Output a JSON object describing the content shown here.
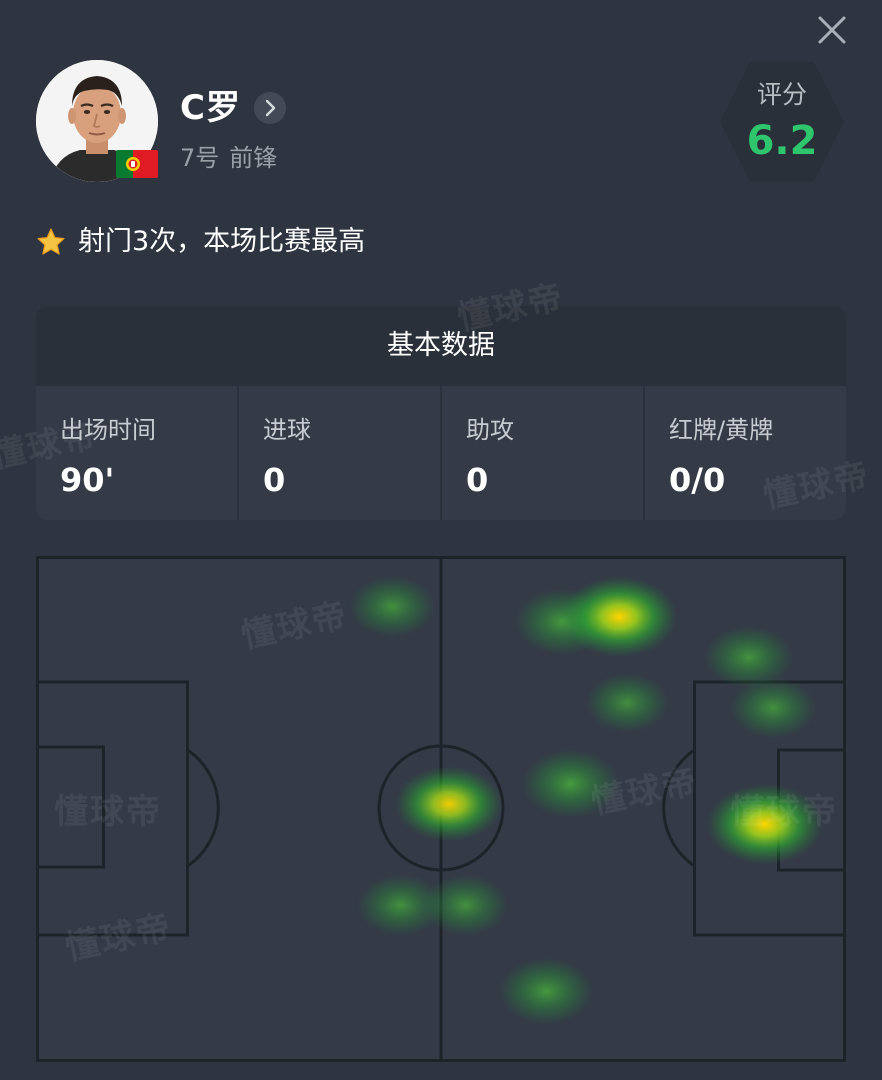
{
  "player": {
    "name": "C罗",
    "number": "7号",
    "position": "前锋",
    "avatar_icon": "player-avatar-icon",
    "flag_icon": "portugal-flag-icon"
  },
  "rating": {
    "label": "评分",
    "value": "6.2",
    "color": "#2ec56c"
  },
  "highlight": {
    "icon": "star-icon",
    "text": "射门3次，本场比赛最高"
  },
  "stats": {
    "title": "基本数据",
    "items": [
      {
        "label": "出场时间",
        "value": "90'"
      },
      {
        "label": "进球",
        "value": "0"
      },
      {
        "label": "助攻",
        "value": "0"
      },
      {
        "label": "红牌/黄牌",
        "value": "0/0"
      }
    ]
  },
  "heatmap": {
    "type": "heatmap",
    "description_icon": "football-pitch-heatmap",
    "spots": [
      {
        "x": 0.44,
        "y": 0.1,
        "intensity": 0.45
      },
      {
        "x": 0.65,
        "y": 0.13,
        "intensity": 0.6
      },
      {
        "x": 0.72,
        "y": 0.12,
        "intensity": 1.0
      },
      {
        "x": 0.88,
        "y": 0.2,
        "intensity": 0.5
      },
      {
        "x": 0.91,
        "y": 0.3,
        "intensity": 0.45
      },
      {
        "x": 0.73,
        "y": 0.29,
        "intensity": 0.4
      },
      {
        "x": 0.51,
        "y": 0.49,
        "intensity": 0.85
      },
      {
        "x": 0.66,
        "y": 0.45,
        "intensity": 0.65
      },
      {
        "x": 0.9,
        "y": 0.53,
        "intensity": 1.0
      },
      {
        "x": 0.45,
        "y": 0.69,
        "intensity": 0.45
      },
      {
        "x": 0.53,
        "y": 0.69,
        "intensity": 0.45
      },
      {
        "x": 0.63,
        "y": 0.86,
        "intensity": 0.6
      }
    ]
  },
  "watermark_text": "懂球帝"
}
